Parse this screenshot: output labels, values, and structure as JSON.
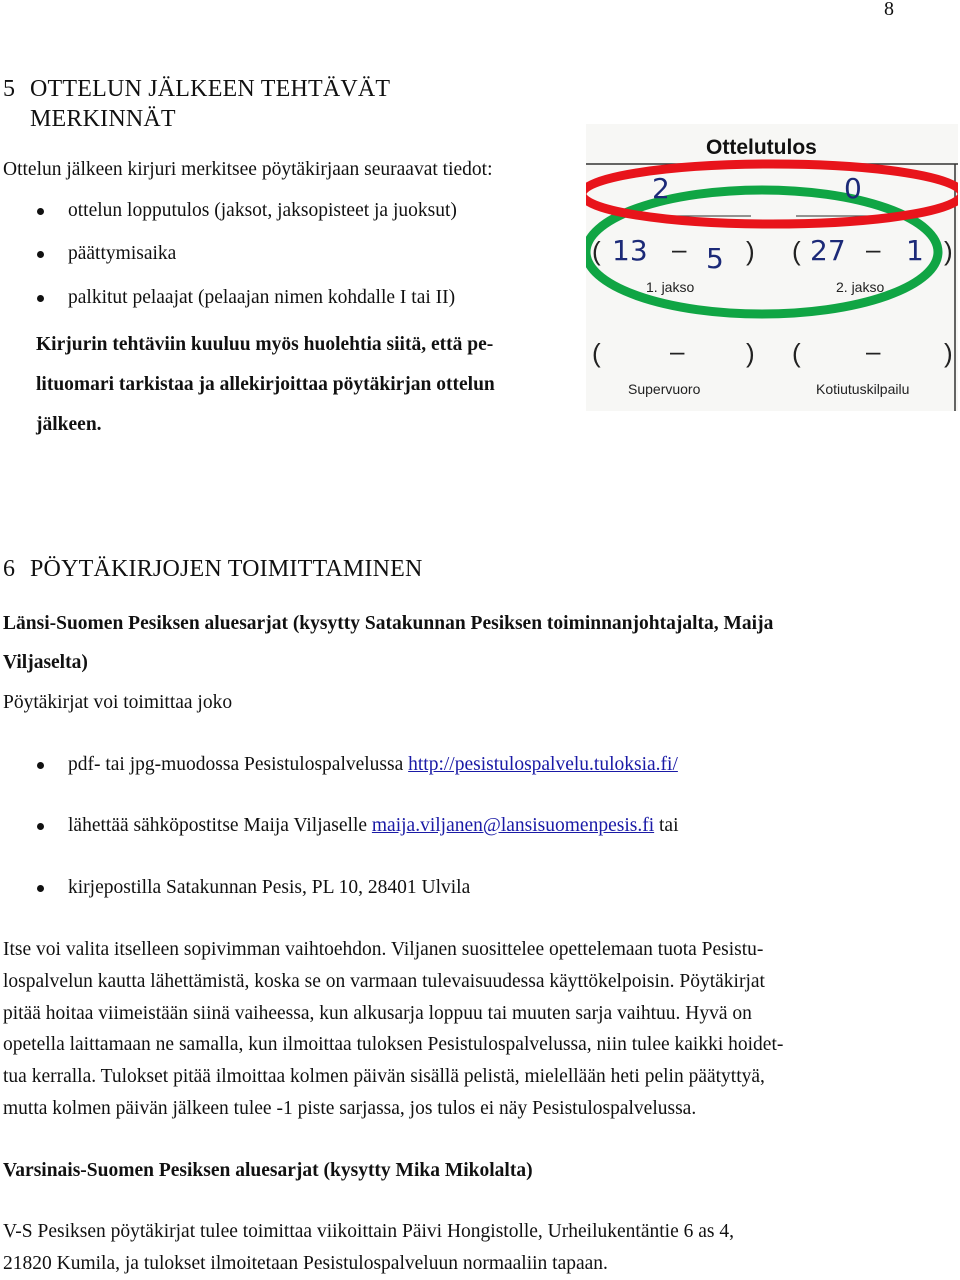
{
  "page_number": "8",
  "section5": {
    "number": "5",
    "title_line1": "OTTELUN JÄLKEEN TEHTÄVÄT",
    "title_line2": "MERKINNÄT",
    "intro": "Ottelun jälkeen kirjuri merkitsee pöytäkirjaan seuraavat tiedot:",
    "bullets": [
      "ottelun lopputulos (jaksot, jaksopisteet ja juoksut)",
      "päättymisaika",
      "palkitut pelaajat (pelaajan nimen kohdalle I tai II)"
    ],
    "bold_note": "Kirjurin tehtäviin kuuluu myös huolehtia siitä, että pe-lituomari tarkistaa ja allekirjoittaa pöytäkirjan ottelun jälkeen.",
    "bold_note_lines": [
      "Kirjurin tehtäviin kuuluu myös huolehtia siitä, että pe-",
      "lituomari tarkistaa ja allekirjoittaa pöytäkirjan ottelun",
      "jälkeen."
    ]
  },
  "scoresheet": {
    "title": "Ottelutulos",
    "final_score": {
      "home": "2",
      "away": "0"
    },
    "period1": {
      "label": "1. jakso",
      "home": "13",
      "away": "5"
    },
    "period2": {
      "label": "2. jakso",
      "home": "27",
      "away": "1"
    },
    "supervuoro_label": "Supervuoro",
    "kotiutuskilpailu_label": "Kotiutuskilpailu",
    "dash": "–",
    "highlight_colors": {
      "final_score_ring": "#e8141b",
      "period_ring": "#10a544"
    }
  },
  "section6": {
    "number": "6",
    "title": "PÖYTÄKIRJOJEN TOIMITTAMINEN",
    "lansi": {
      "heading_line1": "Länsi-Suomen Pesiksen aluesarjat (kysytty Satakunnan Pesiksen toiminnanjohtajalta, Maija",
      "heading_line2": "Viljaselta)",
      "intro": "Pöytäkirjat voi toimittaa joko",
      "bullets": [
        {
          "text": "pdf- tai jpg-muodossa Pesistulospalvelussa ",
          "link": "http://pesistulospalvelu.tuloksia.fi/",
          "after": ""
        },
        {
          "text": "lähettää sähköpostitse Maija Viljaselle ",
          "link": "maija.viljanen@lansisuomenpesis.fi",
          "after": " tai"
        },
        {
          "text": "kirjepostilla Satakunnan Pesis, PL 10, 28401 Ulvila",
          "link": "",
          "after": ""
        }
      ],
      "paragraph_lines": [
        "Itse voi valita itselleen sopivimman vaihtoehdon. Viljanen suosittelee opettelemaan tuota Pesistu-",
        "lospalvelun kautta lähettämistä, koska se on varmaan tulevaisuudessa käyttökelpoisin.  Pöytäkirjat",
        "pitää hoitaa viimeistään siinä vaiheessa, kun alkusarja loppuu tai muuten sarja vaihtuu. Hyvä on",
        "opetella laittamaan ne samalla, kun ilmoittaa tuloksen Pesistulospalvelussa, niin tulee kaikki hoidet-",
        "tua kerralla. Tulokset pitää ilmoittaa kolmen päivän sisällä pelistä, mielellään heti pelin päätyttyä,",
        "mutta kolmen päivän jälkeen tulee -1 piste sarjassa, jos tulos ei näy Pesistulospalvelussa."
      ]
    },
    "varsinais": {
      "heading": "Varsinais-Suomen Pesiksen aluesarjat (kysytty Mika Mikolalta)",
      "paragraph_lines": [
        "V-S Pesiksen pöytäkirjat tulee toimittaa viikoittain Päivi Hongistolle, Urheilukentäntie 6 as 4,",
        "21820 Kumila, ja tulokset ilmoitetaan Pesistulospalveluun normaaliin tapaan."
      ]
    }
  }
}
